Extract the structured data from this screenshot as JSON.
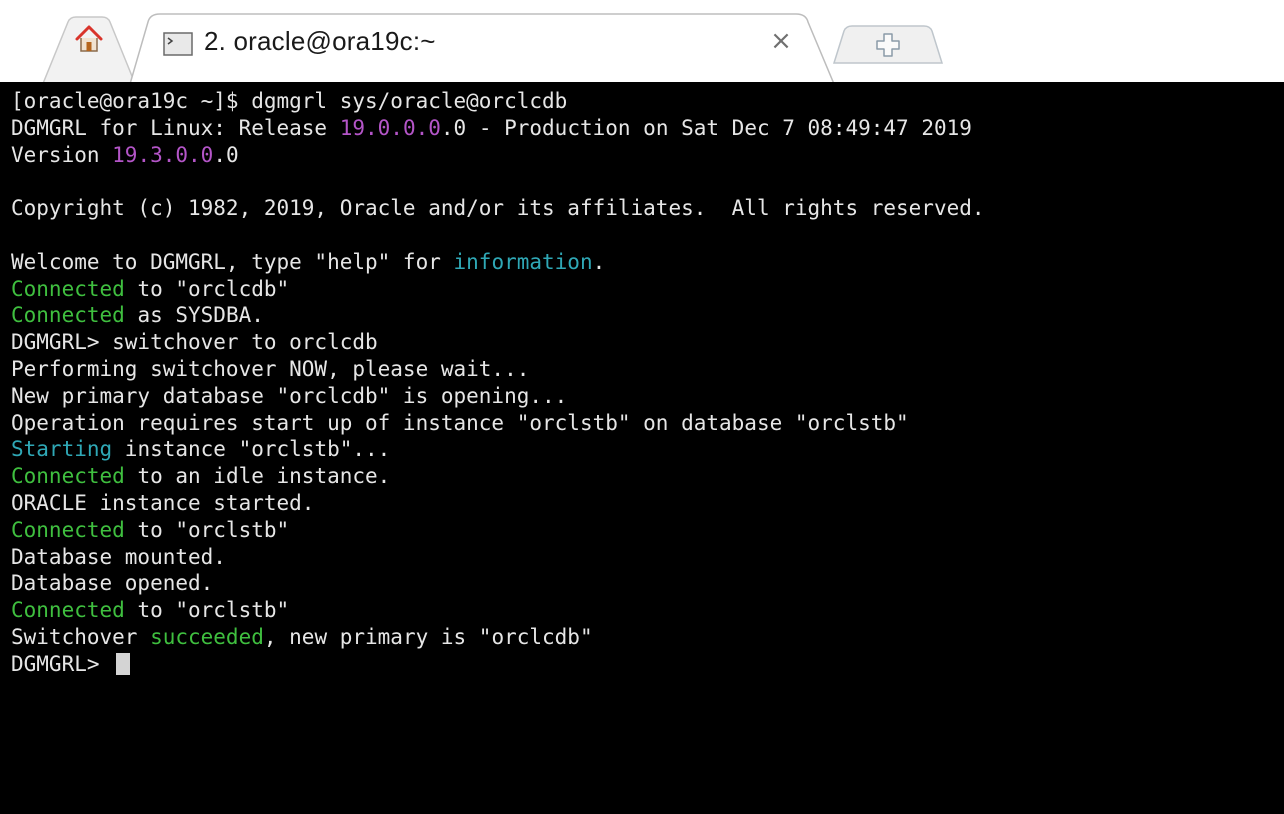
{
  "tabs": {
    "home": {
      "icon": "home-icon"
    },
    "active": {
      "icon": "terminal-icon",
      "title": "2. oracle@ora19c:~",
      "close_label": "×"
    },
    "new_tab": {
      "icon": "plus-icon"
    }
  },
  "colors": {
    "background": "#000000",
    "text": "#e6e6e6",
    "magenta": "#b455c8",
    "green": "#3fbf3f",
    "cyan": "#2fa8b6"
  },
  "terminal": {
    "lines": [
      [
        {
          "t": "[oracle@ora19c ~]$ dgmgrl sys/oracle@orclcdb"
        }
      ],
      [
        {
          "t": "DGMGRL for Linux: Release "
        },
        {
          "t": "19.0.0.0",
          "c": "magenta"
        },
        {
          "t": ".0 - Production on Sat Dec 7 08:49:47 2019"
        }
      ],
      [
        {
          "t": "Version "
        },
        {
          "t": "19.3.0.0",
          "c": "magenta"
        },
        {
          "t": ".0"
        }
      ],
      [
        {
          "t": ""
        }
      ],
      [
        {
          "t": "Copyright (c) 1982, 2019, Oracle and/or its affiliates.  All rights reserved."
        }
      ],
      [
        {
          "t": ""
        }
      ],
      [
        {
          "t": "Welcome to DGMGRL, type \"help\" for "
        },
        {
          "t": "information",
          "c": "cyan"
        },
        {
          "t": "."
        }
      ],
      [
        {
          "t": "Connected",
          "c": "green"
        },
        {
          "t": " to \"orclcdb\""
        }
      ],
      [
        {
          "t": "Connected",
          "c": "green"
        },
        {
          "t": " as SYSDBA."
        }
      ],
      [
        {
          "t": "DGMGRL> switchover to orclcdb"
        }
      ],
      [
        {
          "t": "Performing switchover NOW, please wait..."
        }
      ],
      [
        {
          "t": "New primary database \"orclcdb\" is opening..."
        }
      ],
      [
        {
          "t": "Operation requires start up of instance \"orclstb\" on database \"orclstb\""
        }
      ],
      [
        {
          "t": "Starting",
          "c": "cyan"
        },
        {
          "t": " instance \"orclstb\"..."
        }
      ],
      [
        {
          "t": "Connected",
          "c": "green"
        },
        {
          "t": " to an idle instance."
        }
      ],
      [
        {
          "t": "ORACLE instance started."
        }
      ],
      [
        {
          "t": "Connected",
          "c": "green"
        },
        {
          "t": " to \"orclstb\""
        }
      ],
      [
        {
          "t": "Database mounted."
        }
      ],
      [
        {
          "t": "Database opened."
        }
      ],
      [
        {
          "t": "Connected",
          "c": "green"
        },
        {
          "t": " to \"orclstb\""
        }
      ],
      [
        {
          "t": "Switchover "
        },
        {
          "t": "succeeded",
          "c": "green"
        },
        {
          "t": ", new primary is \"orclcdb\""
        }
      ],
      [
        {
          "t": "DGMGRL> "
        }
      ]
    ],
    "cursor_line": 21
  }
}
